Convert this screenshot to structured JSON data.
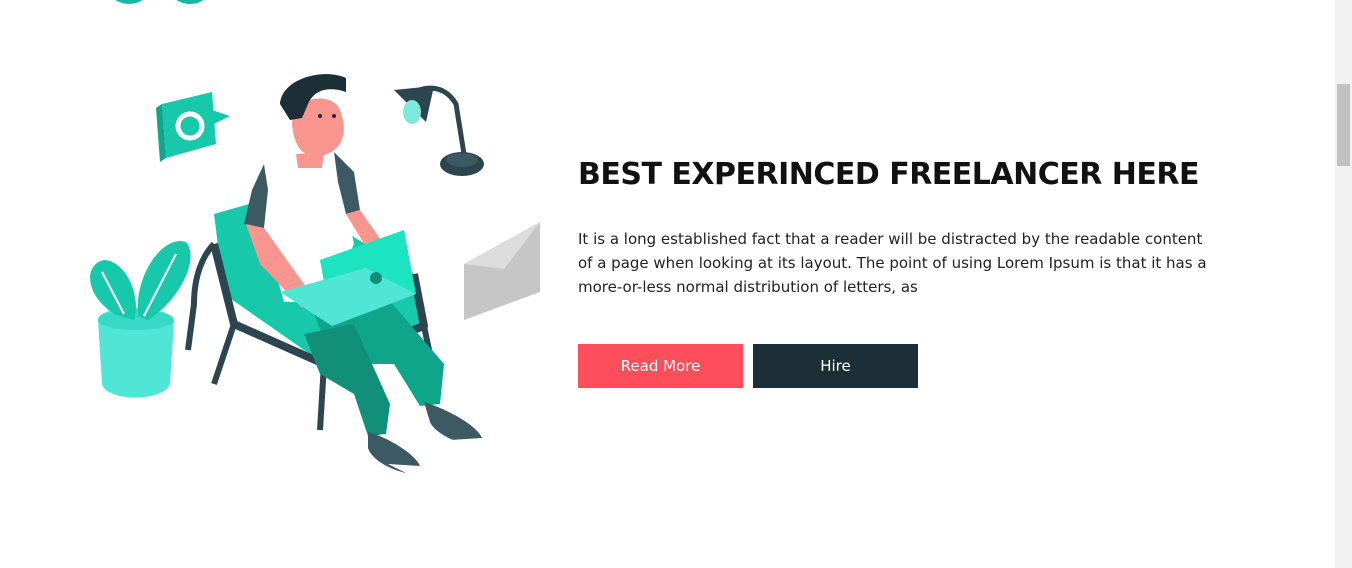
{
  "hero": {
    "headline": "BEST EXPERINCED FREELANCER HERE",
    "description": "It is a long established fact that a reader will be distracted by the readable content of a page when looking at its layout. The point of using Lorem Ipsum is that it has a more-or-less normal distribution of letters, as",
    "buttons": {
      "read_more_label": "Read More",
      "hire_label": "Hire"
    },
    "illustration_icon": "freelancer-laptop-illustration"
  },
  "colors": {
    "accent_red": "#ff4e5b",
    "dark_navy": "#1c2e36",
    "teal": "#1ce3c0"
  }
}
